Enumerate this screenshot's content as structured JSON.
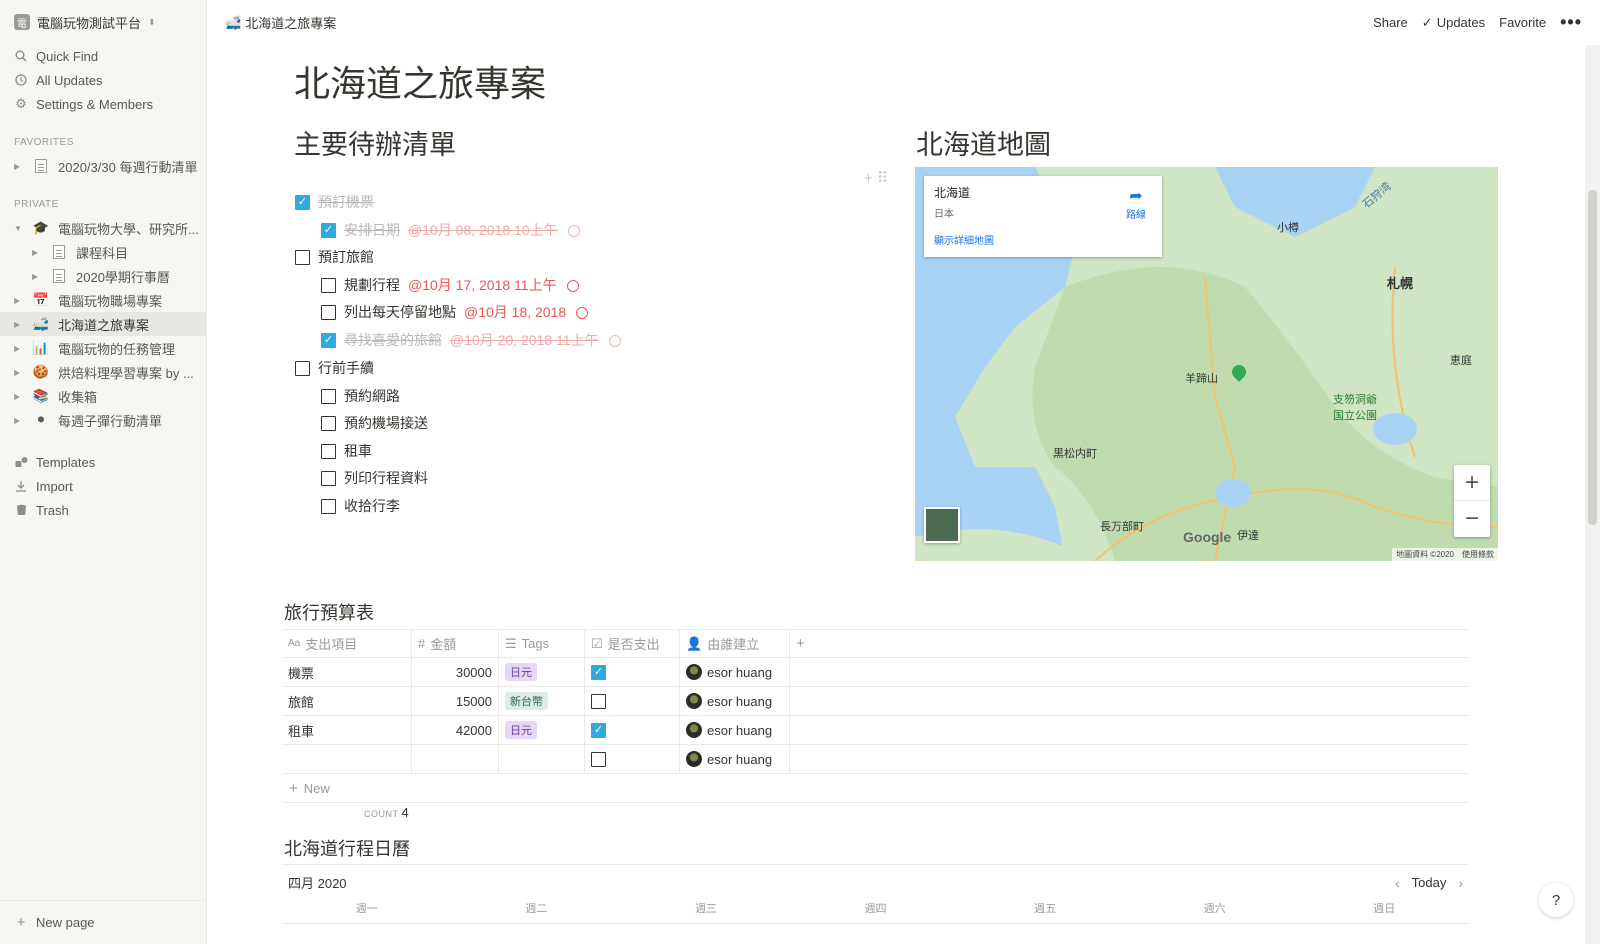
{
  "sidebar": {
    "workspace": {
      "logo": "電",
      "name": "電腦玩物測試平台"
    },
    "nav": [
      {
        "label": "Quick Find",
        "icon": "search-icon"
      },
      {
        "label": "All Updates",
        "icon": "clock-icon"
      },
      {
        "label": "Settings & Members",
        "icon": "gear-icon"
      }
    ],
    "favorites_heading": "FAVORITES",
    "favorites": [
      {
        "label": "2020/3/30 每週行動清單"
      }
    ],
    "private_heading": "PRIVATE",
    "private": [
      {
        "label": "電腦玩物大學、研究所...",
        "emoji": "🎓"
      },
      {
        "label": "課程科目"
      },
      {
        "label": "2020學期行事曆"
      },
      {
        "label": "電腦玩物職場專案",
        "emoji": "📅"
      },
      {
        "label": "北海道之旅專案",
        "emoji": "🚅"
      },
      {
        "label": "電腦玩物的任務管理",
        "emoji": "📊"
      },
      {
        "label": "烘焙料理學習專案 by ...",
        "emoji": "🍪"
      },
      {
        "label": "收集箱",
        "emoji": "📚"
      },
      {
        "label": "每週子彈行動清單",
        "emoji": "⚫"
      }
    ],
    "bottom_nav": [
      {
        "label": "Templates",
        "icon": "templates-icon"
      },
      {
        "label": "Import",
        "icon": "import-icon"
      },
      {
        "label": "Trash",
        "icon": "trash-icon"
      }
    ],
    "new_page": "New page"
  },
  "topbar": {
    "breadcrumb": "北海道之旅專案",
    "breadcrumb_emoji": "🚅",
    "share": "Share",
    "updates": "Updates",
    "favorite": "Favorite",
    "more": "•••"
  },
  "page": {
    "title": "北海道之旅專案",
    "todo_heading": "主要待辦清單",
    "map_heading": "北海道地圖",
    "todos": [
      {
        "text": "預訂機票",
        "checked": true
      },
      {
        "text": "安排日期",
        "checked": true,
        "mention": "@10月 08, 2018 10上午"
      },
      {
        "text": "預訂旅館",
        "checked": false
      },
      {
        "text": "規劃行程",
        "checked": false,
        "mention": "@10月 17, 2018 11上午"
      },
      {
        "text": "列出每天停留地點",
        "checked": false,
        "mention": "@10月 18, 2018"
      },
      {
        "text": "尋找喜愛的旅館",
        "checked": true,
        "mention": "@10月 20, 2018 11上午"
      },
      {
        "text": "行前手續",
        "checked": false
      },
      {
        "text": "預約網路",
        "checked": false
      },
      {
        "text": "預約機場接送",
        "checked": false
      },
      {
        "text": "租車",
        "checked": false
      },
      {
        "text": "列印行程資料",
        "checked": false
      },
      {
        "text": "收拾行李",
        "checked": false
      }
    ],
    "map": {
      "card_title": "北海道",
      "card_sub": "日本",
      "card_link": "顯示詳細地圖",
      "directions": "路線",
      "labels": [
        "小樽",
        "札幌",
        "羊蹄山",
        "支笏洞爺国立公園",
        "黒松内町",
        "長万部町",
        "伊達",
        "恵庭",
        "石狩湾"
      ],
      "google": "Google",
      "footer": "地圖資料 ©2020　使用條款",
      "zoom_in": "+",
      "zoom_out": "−"
    },
    "budget": {
      "title": "旅行預算表",
      "columns": [
        "支出項目",
        "金額",
        "Tags",
        "是否支出",
        "由誰建立"
      ],
      "rows": [
        {
          "item": "機票",
          "amount": "30000",
          "tag": "日元",
          "tag_color": "purple",
          "paid": true,
          "by": "esor huang"
        },
        {
          "item": "旅館",
          "amount": "15000",
          "tag": "新台幣",
          "tag_color": "green",
          "paid": false,
          "by": "esor huang"
        },
        {
          "item": "租車",
          "amount": "42000",
          "tag": "日元",
          "tag_color": "purple",
          "paid": true,
          "by": "esor huang"
        },
        {
          "item": "",
          "amount": "",
          "tag": "",
          "tag_color": "",
          "paid": false,
          "by": "esor huang"
        }
      ],
      "new_label": "New",
      "count_label": "COUNT",
      "count_value": "4"
    },
    "calendar": {
      "title": "北海道行程日曆",
      "month": "四月 2020",
      "today": "Today",
      "days": [
        "週一",
        "週二",
        "週三",
        "週四",
        "週五",
        "週六",
        "週日"
      ]
    }
  },
  "help": "?"
}
